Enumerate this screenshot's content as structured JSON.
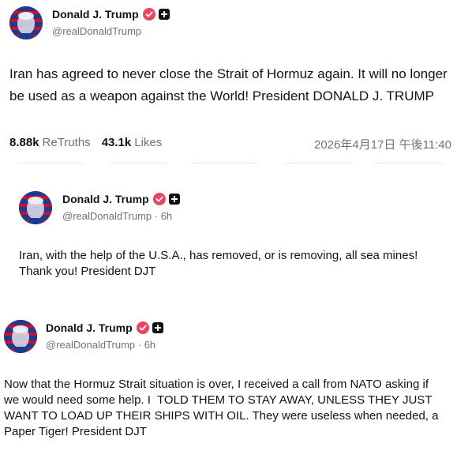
{
  "post1": {
    "author_name": "Donald J. Trump",
    "handle": "@realDonaldTrump",
    "text": "Iran has agreed to never close the Strait of Hormuz again. It will no longer be used as a weapon against the World! President DONALD J. TRUMP",
    "retruths_count": "8.88k",
    "retruths_label": "ReTruths",
    "likes_count": "43.1k",
    "likes_label": "Likes",
    "timestamp": "2026年4月17日 午後11:40"
  },
  "post2": {
    "author_name": "Donald J. Trump",
    "handle_time": "@realDonaldTrump · 6h",
    "text": "Iran, with the help of the U.S.A., has removed, or is removing, all sea mines! Thank you! President DJT"
  },
  "post3": {
    "author_name": "Donald J. Trump",
    "handle_time": "@realDonaldTrump · 6h",
    "text": "Now that the Hormuz Strait situation is over, I received a call from NATO asking if we would need some help. I  TOLD THEM TO STAY AWAY, UNLESS THEY JUST WANT TO LOAD UP THEIR SHIPS WITH OIL. They were useless when needed, a Paper Tiger! President DJT"
  },
  "icons": {
    "verified": "verified-badge-icon",
    "plus": "truth-plus-icon"
  },
  "colors": {
    "verified_badge": "#e8475f",
    "muted_text": "#6b7280",
    "text": "#0f1419"
  }
}
